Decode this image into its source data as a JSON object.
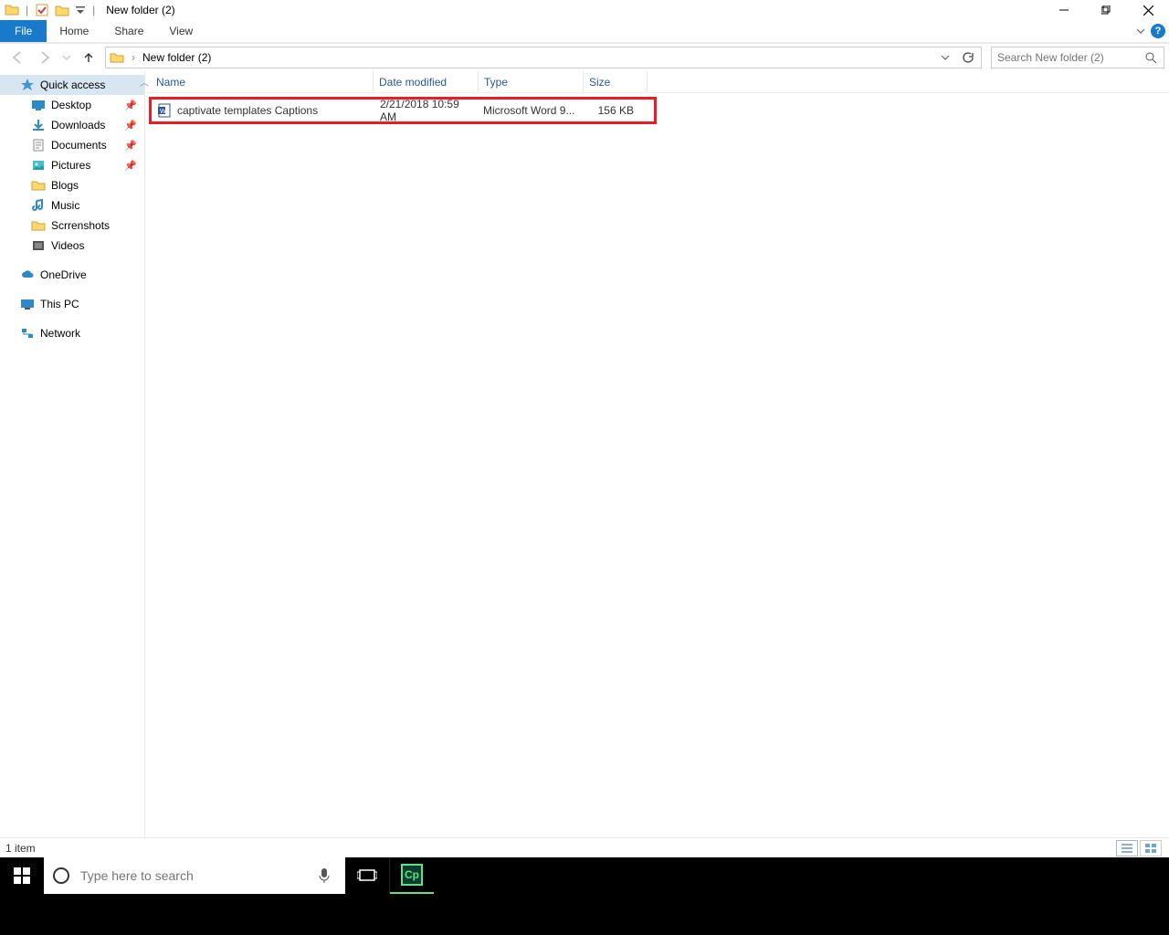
{
  "title": "New folder (2)",
  "ribbon": {
    "file": "File",
    "home": "Home",
    "share": "Share",
    "view": "View"
  },
  "breadcrumb": {
    "current": "New folder (2)"
  },
  "search": {
    "placeholder": "Search New folder (2)"
  },
  "sidebar": {
    "quick_access": "Quick access",
    "items": [
      {
        "label": "Desktop",
        "pin": true
      },
      {
        "label": "Downloads",
        "pin": true
      },
      {
        "label": "Documents",
        "pin": true
      },
      {
        "label": "Pictures",
        "pin": true
      },
      {
        "label": "Blogs",
        "pin": false
      },
      {
        "label": "Music",
        "pin": false
      },
      {
        "label": "Scrrenshots",
        "pin": false
      },
      {
        "label": "Videos",
        "pin": false
      }
    ],
    "onedrive": "OneDrive",
    "thispc": "This PC",
    "network": "Network"
  },
  "columns": {
    "name": "Name",
    "date": "Date modified",
    "type": "Type",
    "size": "Size"
  },
  "file": {
    "name": "captivate templates Captions",
    "date": "2/21/2018 10:59 AM",
    "type": "Microsoft Word 9...",
    "size": "156 KB"
  },
  "status": {
    "count": "1 item"
  },
  "taskbar": {
    "search_placeholder": "Type here to search",
    "cp": "Cp"
  }
}
